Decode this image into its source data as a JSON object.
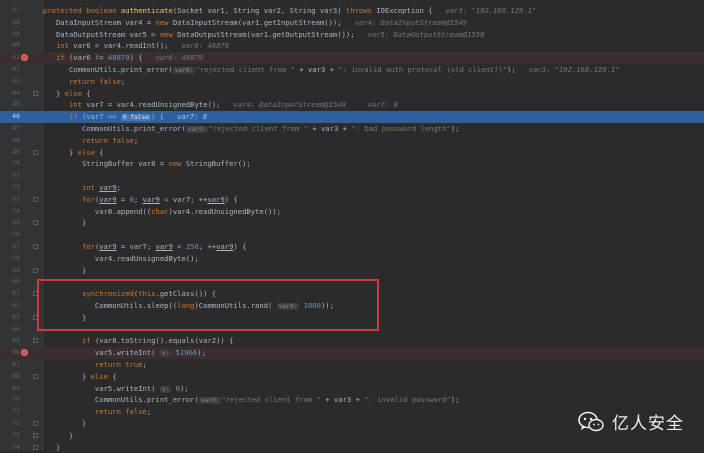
{
  "watermark": {
    "text": "亿人安全"
  },
  "lines": [
    {
      "n": "37",
      "style": "",
      "tokens": [
        [
          "kw",
          "protected boolean "
        ],
        [
          "fn",
          "authenticate"
        ],
        [
          "txt",
          "(Socket var1, String var2, String var3) "
        ],
        [
          "kw",
          "throws "
        ],
        [
          "txt",
          "IOException {   "
        ],
        [
          "hint",
          "var3: \"192.168.129.1\""
        ]
      ]
    },
    {
      "n": "38",
      "style": "",
      "tokens": [
        [
          "txt",
          "   DataInputStream var4 = "
        ],
        [
          "kw",
          "new "
        ],
        [
          "txt",
          "DataInputStream(var1.getInputStream());   "
        ],
        [
          "hint",
          "var4: DataInputStream@1549"
        ]
      ]
    },
    {
      "n": "39",
      "style": "",
      "tokens": [
        [
          "txt",
          "   DataOutputStream var5 = "
        ],
        [
          "kw",
          "new "
        ],
        [
          "txt",
          "DataOutputStream(var1.getOutputStream());   "
        ],
        [
          "hint",
          "var5: DataOutputStream@1550"
        ]
      ]
    },
    {
      "n": "40",
      "style": "",
      "tokens": [
        [
          "kw",
          "   int "
        ],
        [
          "txt",
          "var6 = var4.readInt();   "
        ],
        [
          "hint",
          "var6: 48879"
        ]
      ]
    },
    {
      "n": "41",
      "style": "bpline",
      "tokens": [
        [
          "kw",
          "   if "
        ],
        [
          "txt",
          "(var6 != "
        ],
        [
          "num",
          "48879"
        ],
        [
          "txt",
          ") {   "
        ],
        [
          "hint",
          "var6: 48879"
        ]
      ]
    },
    {
      "n": "42",
      "style": "",
      "tokens": [
        [
          "txt",
          "      CommonUtils."
        ],
        [
          "txt",
          "print_error("
        ],
        [
          "inl",
          "var0:"
        ],
        [
          "str",
          "\"rejected client from \""
        ],
        [
          "txt",
          " + var3 + "
        ],
        [
          "str",
          "\": invalid auth protocol (old client?)\""
        ],
        [
          "txt",
          ");   "
        ],
        [
          "hint",
          "var3: \"192.168.129.1\""
        ]
      ]
    },
    {
      "n": "43",
      "style": "",
      "tokens": [
        [
          "kw",
          "      return false"
        ],
        [
          "txt",
          ";"
        ]
      ]
    },
    {
      "n": "44",
      "style": "",
      "tokens": [
        [
          "txt",
          "   } "
        ],
        [
          "kw",
          "else "
        ],
        [
          "txt",
          "{"
        ]
      ]
    },
    {
      "n": "45",
      "style": "",
      "tokens": [
        [
          "kw",
          "      int "
        ],
        [
          "txt",
          "var7 = var4.readUnsignedByte();   "
        ],
        [
          "hint",
          "var4: DataInputStream@1549     var7: 8"
        ]
      ]
    },
    {
      "n": "46",
      "style": "exec",
      "tokens": [
        [
          "kw",
          "      if "
        ],
        [
          "txt",
          "(var7 <= "
        ],
        [
          "inl",
          "0 false"
        ],
        [
          "txt",
          ") {   "
        ],
        [
          "hint",
          "var7: 8"
        ]
      ]
    },
    {
      "n": "47",
      "style": "",
      "tokens": [
        [
          "txt",
          "         CommonUtils."
        ],
        [
          "txt",
          "print_error("
        ],
        [
          "inl",
          "var0:"
        ],
        [
          "str",
          "\"rejected client from \""
        ],
        [
          "txt",
          " + var3 + "
        ],
        [
          "str",
          "\": bad password length\""
        ],
        [
          "txt",
          ");"
        ]
      ]
    },
    {
      "n": "48",
      "style": "",
      "tokens": [
        [
          "kw",
          "         return false"
        ],
        [
          "txt",
          ";"
        ]
      ]
    },
    {
      "n": "49",
      "style": "",
      "tokens": [
        [
          "txt",
          "      } "
        ],
        [
          "kw",
          "else "
        ],
        [
          "txt",
          "{"
        ]
      ]
    },
    {
      "n": "50",
      "style": "",
      "tokens": [
        [
          "txt",
          "         StringBuffer var8 = "
        ],
        [
          "kw",
          "new "
        ],
        [
          "txt",
          "StringBuffer();"
        ]
      ]
    },
    {
      "n": "51",
      "style": "",
      "tokens": []
    },
    {
      "n": "52",
      "style": "",
      "tokens": [
        [
          "kw",
          "         int "
        ],
        [
          "ulvar",
          "var9"
        ],
        [
          "txt",
          ";"
        ]
      ]
    },
    {
      "n": "53",
      "style": "",
      "tokens": [
        [
          "kw",
          "         for"
        ],
        [
          "txt",
          "("
        ],
        [
          "ulvar",
          "var9"
        ],
        [
          "txt",
          " = "
        ],
        [
          "num",
          "0"
        ],
        [
          "txt",
          "; "
        ],
        [
          "ulvar",
          "var9"
        ],
        [
          "txt",
          " < var7; ++"
        ],
        [
          "ulvar",
          "var9"
        ],
        [
          "txt",
          ") {"
        ]
      ]
    },
    {
      "n": "54",
      "style": "",
      "tokens": [
        [
          "txt",
          "            var8.append(("
        ],
        [
          "kw",
          "char"
        ],
        [
          "txt",
          ")var4.readUnsignedByte());"
        ]
      ]
    },
    {
      "n": "55",
      "style": "",
      "tokens": [
        [
          "txt",
          "         }"
        ]
      ]
    },
    {
      "n": "56",
      "style": "",
      "tokens": []
    },
    {
      "n": "57",
      "style": "",
      "tokens": [
        [
          "kw",
          "         for"
        ],
        [
          "txt",
          "("
        ],
        [
          "ulvar",
          "var9"
        ],
        [
          "txt",
          " = var7; "
        ],
        [
          "ulvar",
          "var9"
        ],
        [
          "txt",
          " < "
        ],
        [
          "num",
          "256"
        ],
        [
          "txt",
          "; ++"
        ],
        [
          "ulvar",
          "var9"
        ],
        [
          "txt",
          ") {"
        ]
      ]
    },
    {
      "n": "58",
      "style": "",
      "tokens": [
        [
          "txt",
          "            var4.readUnsignedByte();"
        ]
      ]
    },
    {
      "n": "59",
      "style": "",
      "tokens": [
        [
          "txt",
          "         }"
        ]
      ]
    },
    {
      "n": "60",
      "style": "",
      "tokens": []
    },
    {
      "n": "61",
      "style": "",
      "tokens": [
        [
          "kw",
          "         synchronized"
        ],
        [
          "txt",
          "("
        ],
        [
          "kw",
          "this"
        ],
        [
          "txt",
          ".getClass()) {"
        ]
      ]
    },
    {
      "n": "62",
      "style": "",
      "tokens": [
        [
          "txt",
          "            CommonUtils.sleep(("
        ],
        [
          "kw",
          "long"
        ],
        [
          "txt",
          ")CommonUtils.rand( "
        ],
        [
          "inl",
          "var0:"
        ],
        [
          "num",
          " 1000"
        ],
        [
          "txt",
          "));"
        ]
      ]
    },
    {
      "n": "63",
      "style": "",
      "tokens": [
        [
          "txt",
          "         }"
        ]
      ]
    },
    {
      "n": "64",
      "style": "",
      "tokens": []
    },
    {
      "n": "65",
      "style": "",
      "tokens": [
        [
          "kw",
          "         if "
        ],
        [
          "txt",
          "(var8.toString().equals(var2)) {"
        ]
      ]
    },
    {
      "n": "66",
      "style": "bpline",
      "tokens": [
        [
          "txt",
          "            var5.writeInt( "
        ],
        [
          "inl",
          "v:"
        ],
        [
          "num",
          " 51966"
        ],
        [
          "txt",
          ");"
        ]
      ]
    },
    {
      "n": "67",
      "style": "",
      "tokens": [
        [
          "kw",
          "            return true"
        ],
        [
          "txt",
          ";"
        ]
      ]
    },
    {
      "n": "68",
      "style": "",
      "tokens": [
        [
          "txt",
          "         } "
        ],
        [
          "kw",
          "else "
        ],
        [
          "txt",
          "{"
        ]
      ]
    },
    {
      "n": "69",
      "style": "",
      "tokens": [
        [
          "txt",
          "            var5.writeInt( "
        ],
        [
          "inl",
          "v:"
        ],
        [
          "num",
          " 0"
        ],
        [
          "txt",
          ");"
        ]
      ]
    },
    {
      "n": "70",
      "style": "",
      "tokens": [
        [
          "txt",
          "            CommonUtils.print_error("
        ],
        [
          "inl",
          "var0:"
        ],
        [
          "str",
          "\"rejected client from \""
        ],
        [
          "txt",
          " + var3 + "
        ],
        [
          "str",
          "\": invalid password\""
        ],
        [
          "txt",
          ");"
        ]
      ]
    },
    {
      "n": "71",
      "style": "",
      "tokens": [
        [
          "kw",
          "            return false"
        ],
        [
          "txt",
          ";"
        ]
      ]
    },
    {
      "n": "72",
      "style": "",
      "tokens": [
        [
          "txt",
          "         }"
        ]
      ]
    },
    {
      "n": "73",
      "style": "",
      "tokens": [
        [
          "txt",
          "      }"
        ]
      ]
    },
    {
      "n": "74",
      "style": "",
      "tokens": [
        [
          "txt",
          "   }"
        ]
      ]
    }
  ],
  "breakpoint_lines": [
    "41",
    "66"
  ]
}
